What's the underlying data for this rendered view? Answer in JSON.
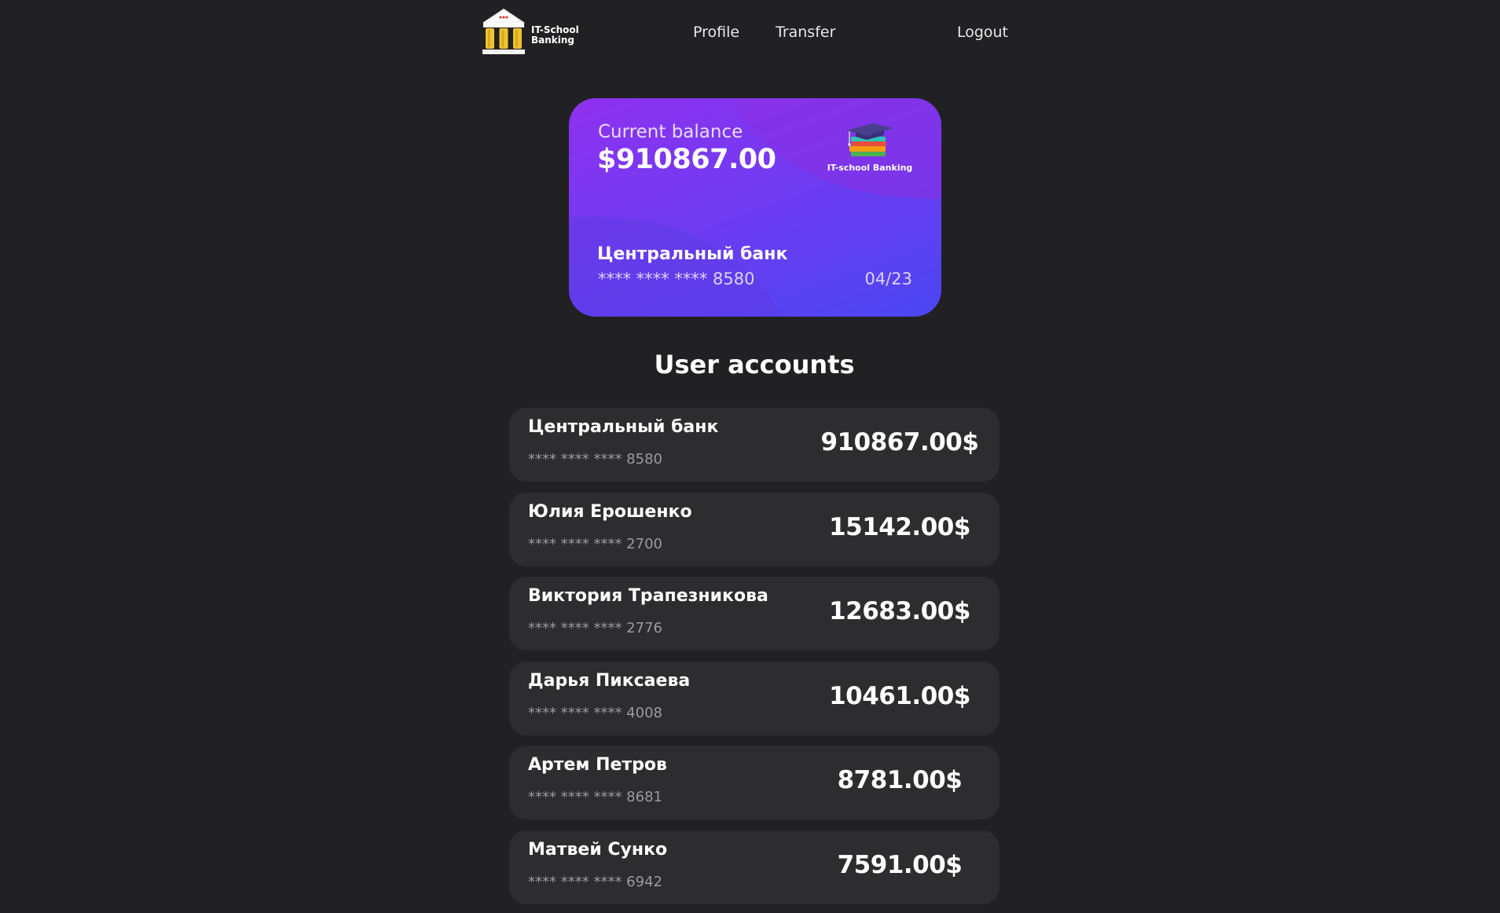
{
  "header": {
    "logo_line1": "IT-School",
    "logo_line2": "Banking",
    "nav": {
      "profile": "Profile",
      "transfer": "Transfer",
      "logout": "Logout"
    }
  },
  "card": {
    "balance_label": "Current balance",
    "balance_value": "$910867.00",
    "brand_label": "IT-school Banking",
    "owner": "Центральный банк",
    "number": "**** **** **** 8580",
    "expiry": "04/23",
    "colors": {
      "gradient_start": "#8f31ef",
      "gradient_end": "#4b46f2"
    }
  },
  "accounts_title": "User accounts",
  "accounts": [
    {
      "name": "Центральный банк",
      "number": "**** **** **** 8580",
      "balance": "910867.00$"
    },
    {
      "name": "Юлия Ерошенко",
      "number": "**** **** **** 2700",
      "balance": "15142.00$"
    },
    {
      "name": "Виктория Трапезникова",
      "number": "**** **** **** 2776",
      "balance": "12683.00$"
    },
    {
      "name": "Дарья Пиксаева",
      "number": "**** **** **** 4008",
      "balance": "10461.00$"
    },
    {
      "name": "Артем Петров",
      "number": "**** **** **** 8681",
      "balance": "8781.00$"
    },
    {
      "name": "Матвей Сунко",
      "number": "**** **** **** 6942",
      "balance": "7591.00$"
    }
  ],
  "icons": {
    "logo": "bank-building-icon",
    "card_brand": "graduation-cap-books-icon"
  },
  "colors": {
    "background": "#212123",
    "row_background": "#2d2d30"
  }
}
